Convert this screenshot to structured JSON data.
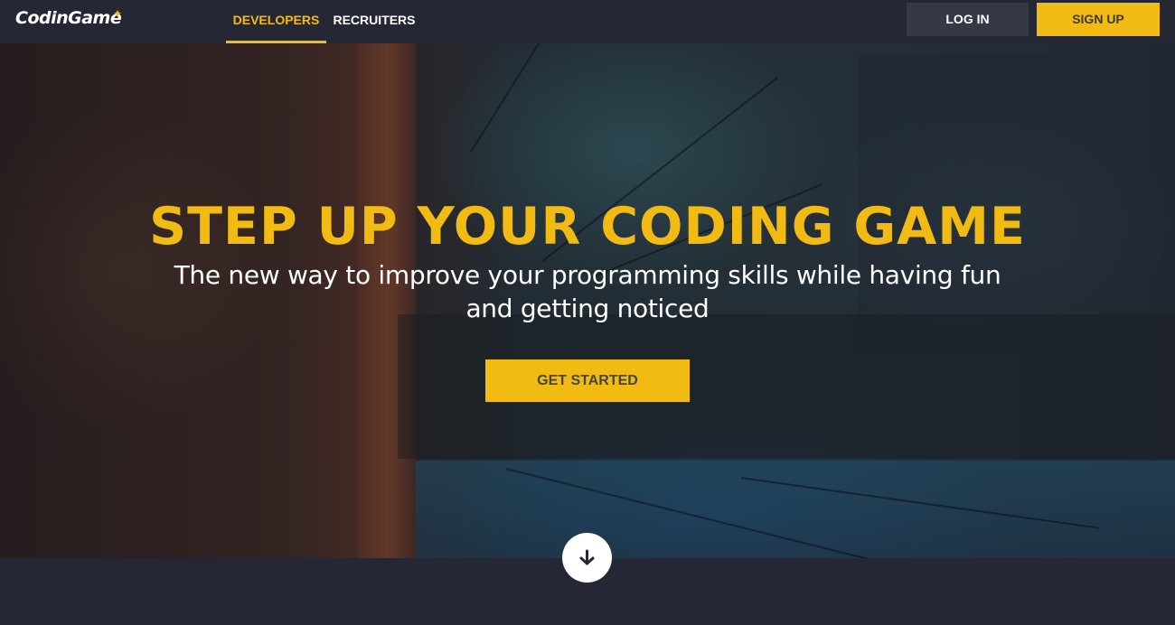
{
  "navbar": {
    "logo_text": "CodinGame",
    "tabs": [
      {
        "label": "DEVELOPERS",
        "active": true
      },
      {
        "label": "RECRUITERS",
        "active": false
      }
    ],
    "login_label": "LOG IN",
    "signup_label": "SIGN UP"
  },
  "hero": {
    "title": "STEP UP YOUR CODING GAME",
    "subtitle": "The new way to improve your programming skills while having fun and getting noticed",
    "cta_label": "GET STARTED"
  },
  "scroll_button": {
    "icon": "arrow-down-icon"
  },
  "colors": {
    "accent": "#f2bb13",
    "navbar_bg": "#252834",
    "login_bg": "#353946",
    "text_light": "#ffffff"
  }
}
